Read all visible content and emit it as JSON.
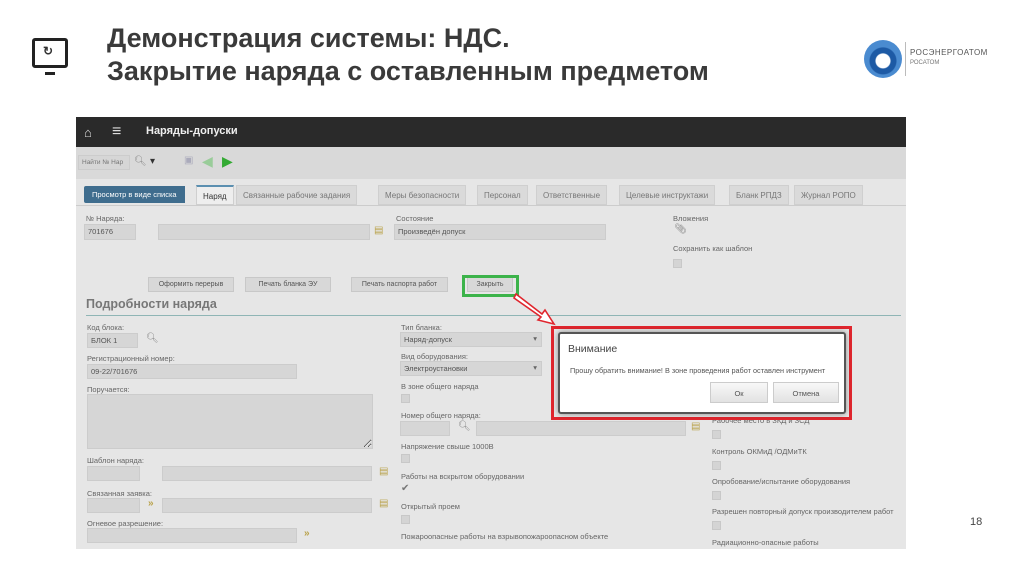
{
  "slide": {
    "title_line1": "Демонстрация системы: НДС.",
    "title_line2": "Закрытие наряда с оставленным предметом",
    "page_number": "18",
    "logo_text1": "РОСЭНЕРГОАТОМ",
    "logo_text2": "РОСАТОМ"
  },
  "app": {
    "header_title": "Наряды-допуски",
    "toolbar": {
      "search_placeholder": "Найти № Нар"
    },
    "back_button": "Просмотр в виде списка",
    "tabs": [
      "Наряд",
      "Связанные рабочие задания",
      "Меры безопасности",
      "Персонал",
      "Ответственные",
      "Целевые инструктажи",
      "Бланк РПДЗ",
      "Журнал РОПО"
    ],
    "top": {
      "order_no_label": "№ Наряда:",
      "order_no": "701676",
      "state_label": "Состояние",
      "state": "Произведён допуск",
      "attachments_label": "Вложения",
      "save_template_label": "Сохранить как шаблон"
    },
    "buttons": {
      "break": "Оформить перерыв",
      "print_eu": "Печать бланка ЭУ",
      "print_passport": "Печать паспорта работ",
      "close": "Закрыть"
    },
    "section_title": "Подробности наряда",
    "left": {
      "block_code_label": "Код блока:",
      "block_code": "БЛОК 1",
      "reg_no_label": "Регистрационный номер:",
      "reg_no": "09-22/701676",
      "assigned_label": "Поручается:",
      "template_label": "Шаблон наряда:",
      "request_label": "Связанная заявка:",
      "fire_label": "Огневое разрешение:"
    },
    "middle": {
      "form_type_label": "Тип бланка:",
      "form_type": "Наряд-допуск",
      "equipment_label": "Вид оборудования:",
      "equipment": "Электроустановки",
      "general_zone_label": "В зоне общего наряда",
      "general_no_label": "Номер общего наряда:",
      "voltage_label": "Напряжение свыше 1000В",
      "opened_label": "Работы на вскрытом оборудовании",
      "opening_label": "Открытый проем",
      "fire_hazard_label": "Пожароопасные работы на взрывопожароопасном объекте"
    },
    "right": {
      "workplace_label": "Рабочее место в ЗКД и ЗСД",
      "control_label": "Контроль ОКМиД /ОДМиТК",
      "testing_label": "Опробование/испытание оборудования",
      "readmit_label": "Разрешен повторный допуск производителем работ",
      "radiation_label": "Радиационно-опасные работы"
    },
    "dialog": {
      "title": "Внимание",
      "message": "Прошу обратить внимание! В зоне проведения работ оставлен инструмент",
      "ok": "Ок",
      "cancel": "Отмена"
    }
  },
  "colors": {
    "highlight_red": "#e0262e",
    "highlight_green": "#3cb34a",
    "header": "#2a2a2a"
  }
}
